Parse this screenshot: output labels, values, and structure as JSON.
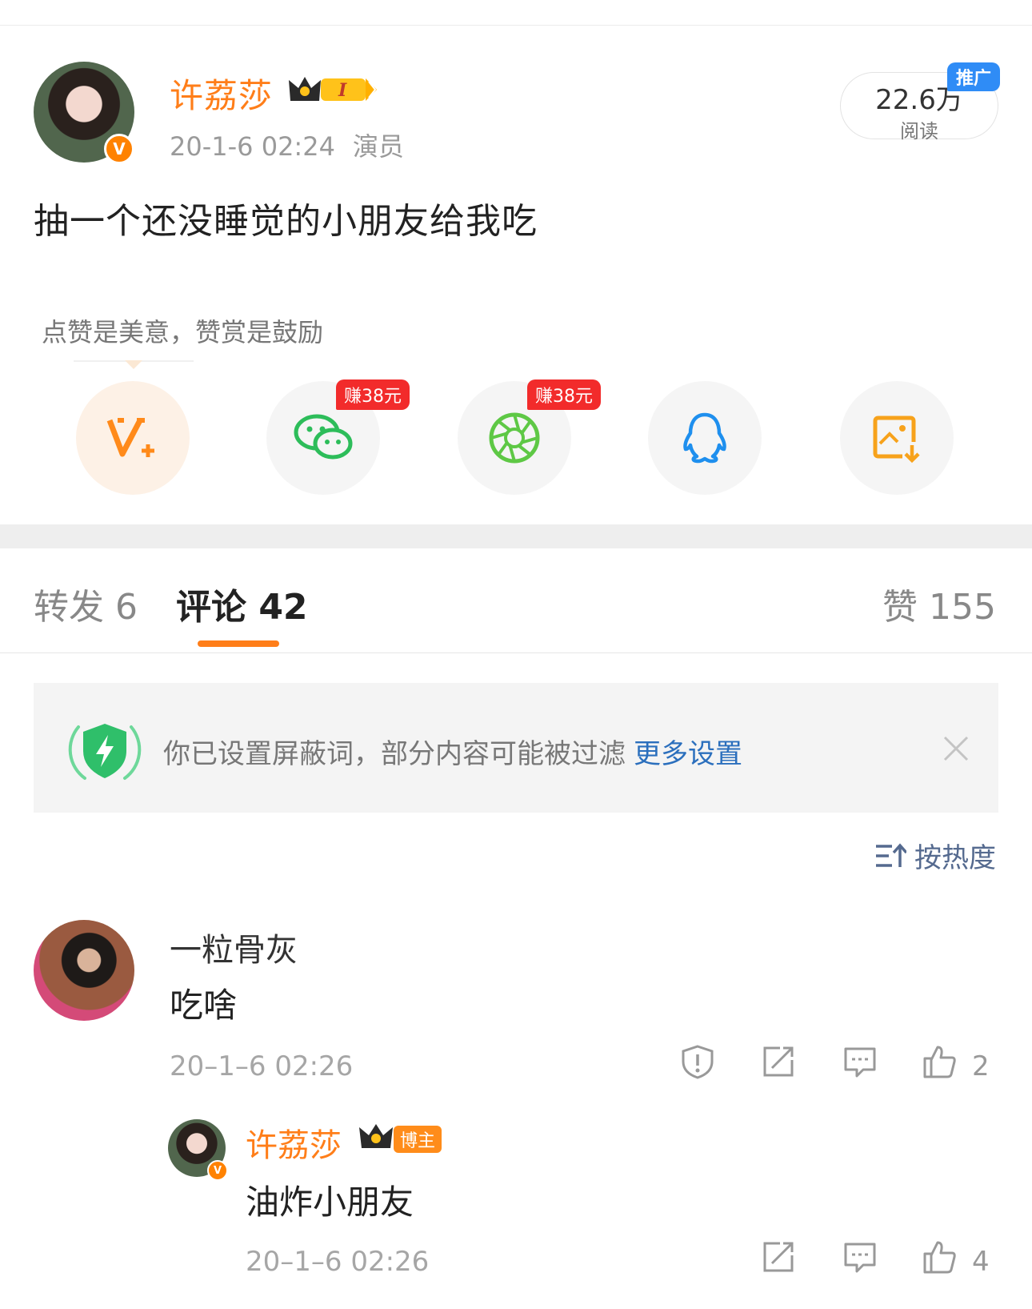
{
  "post": {
    "author": {
      "name": "许荔莎",
      "verified_mark": "V",
      "level_badge": "I",
      "post_time": "20-1-6 02:24",
      "role": "演员"
    },
    "reads": {
      "count": "22.6万",
      "label": "阅读",
      "promo_tag": "推广"
    },
    "text": "抽一个还没睡觉的小朋友给我吃"
  },
  "reward": {
    "hint": "点赞是美意，赞赏是鼓励"
  },
  "share": {
    "items": [
      {
        "icon": "v-plus-icon"
      },
      {
        "icon": "wechat-icon",
        "earn_tag": "赚38元"
      },
      {
        "icon": "moments-icon",
        "earn_tag": "赚38元"
      },
      {
        "icon": "qq-icon"
      },
      {
        "icon": "save-image-icon"
      }
    ]
  },
  "tabs": {
    "repost": "转发 6",
    "comments": "评论 42",
    "likes": "赞 155"
  },
  "filter_notice": {
    "text": "你已设置屏蔽词，部分内容可能被过滤",
    "link": "更多设置"
  },
  "sort": {
    "label": "按热度"
  },
  "comments": [
    {
      "user": "一粒骨灰",
      "text": "吃啥",
      "time": "20–1–6 02:26",
      "likes": "2",
      "reply": {
        "user": "许荔莎",
        "badge": "博主",
        "verified_mark": "V",
        "text": "油炸小朋友",
        "time": "20–1–6 02:26",
        "likes": "4"
      }
    }
  ],
  "colors": {
    "brand_orange": "#ff7e19",
    "link_blue": "#2b6fbd",
    "promo_blue": "#2f8cf6",
    "earn_red": "#f22b2b"
  }
}
